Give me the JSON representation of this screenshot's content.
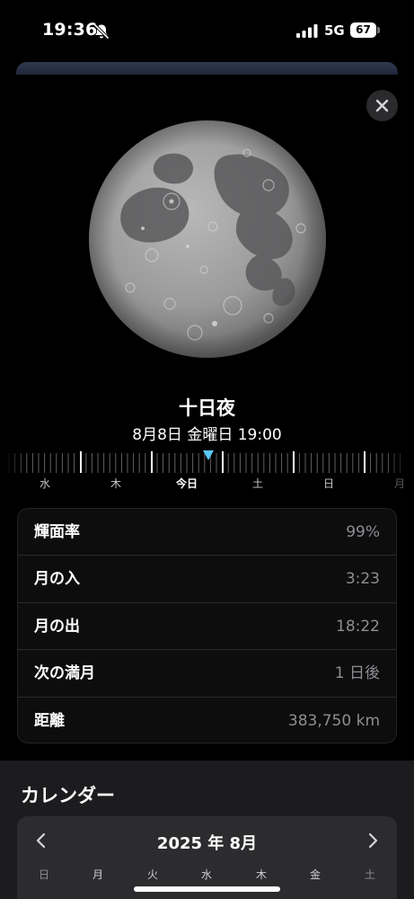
{
  "status_bar": {
    "time": "19:36",
    "network": "5G",
    "battery_level": "67",
    "icons": [
      "bell-slash-icon",
      "signal-icon",
      "battery-icon"
    ]
  },
  "moon": {
    "phase_name": "十日夜",
    "datetime": "8月8日 金曜日 19:00"
  },
  "timeline": {
    "days": [
      {
        "label": "水",
        "today": false
      },
      {
        "label": "木",
        "today": false
      },
      {
        "label": "今日",
        "today": true
      },
      {
        "label": "土",
        "today": false
      },
      {
        "label": "日",
        "today": false
      },
      {
        "label": "月",
        "today": false
      }
    ]
  },
  "info": [
    {
      "label": "輝面率",
      "value": "99%"
    },
    {
      "label": "月の入",
      "value": "3:23"
    },
    {
      "label": "月の出",
      "value": "18:22"
    },
    {
      "label": "次の満月",
      "value": "1 日後"
    },
    {
      "label": "距離",
      "value": "383,750 km"
    }
  ],
  "calendar": {
    "heading": "カレンダー",
    "month": "2025 年 8月",
    "weekdays": [
      "日",
      "月",
      "火",
      "水",
      "木",
      "金",
      "土"
    ]
  },
  "colors": {
    "accent": "#5ac8fa",
    "background": "#000000",
    "card": "#0d0d0e",
    "calendar_bg": "#1c1c1e",
    "secondary_text": "#8e8e93"
  }
}
